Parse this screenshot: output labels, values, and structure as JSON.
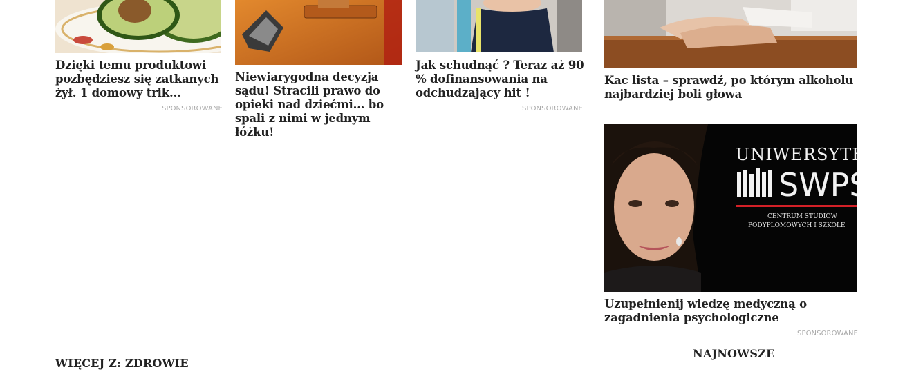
{
  "articles": [
    {
      "title": "Dzięki temu produktowi pozbędziesz się zatkanych żył. 1 domowy trik...",
      "sponsored": "SPONSOROWANE"
    },
    {
      "title": "Niewiarygodna decyzja sądu! Stracili prawo do opieki nad dziećmi... bo spali z nimi w jednym łóżku!",
      "sponsored": ""
    },
    {
      "title": "Jak schudnąć ? Teraz aż 90 % dofinansowania na odchudzający hit !",
      "sponsored": "SPONSOROWANE"
    },
    {
      "title": "Kac lista – sprawdź, po którym alkoholu najbardziej boli głowa",
      "sponsored": ""
    },
    {
      "title": "Uzupełnienij wiedzę medyczną o zagadnienia psychologiczne",
      "sponsored": "SPONSOROWANE"
    }
  ],
  "ad_image": {
    "brand_line1": "UNIWERSYTE",
    "brand_line2": "SWPS",
    "caption_line1": "CENTRUM STUDIÓW",
    "caption_line2": "PODYPLOMOWYCH I SZKOLE"
  },
  "sections": {
    "more_from": "WIĘCEJ Z: ZDROWIE",
    "latest": "NAJNOWSZE"
  }
}
